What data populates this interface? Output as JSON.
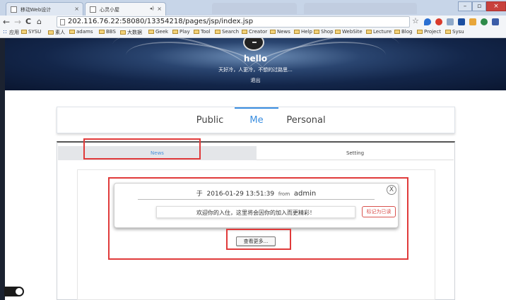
{
  "browser": {
    "tabs": [
      {
        "title": "移动Web设计"
      },
      {
        "title": "心灵小屋"
      }
    ],
    "address": "202.116.76.22:58080/13354218/pages/jsp/index.jsp",
    "bookmarks": [
      "应用",
      "SYSU",
      "素人",
      "adams",
      "BBS",
      "大数据",
      "Geek",
      "Play",
      "Tool",
      "Search",
      "Creator",
      "News",
      "Help",
      "Shop",
      "WebSite",
      "Lecture",
      "Blog",
      "Project",
      "Sysu"
    ]
  },
  "banner": {
    "title": "hello",
    "motto": "天好冷，人更冷，不想的过路思...",
    "logout": "退出"
  },
  "main_tabs": [
    "Public",
    "Me",
    "Personal"
  ],
  "sub_tabs": {
    "news": "News",
    "setting": "Setting"
  },
  "message": {
    "prefix": "于",
    "datetime": "2016-01-29 13:51:39",
    "from_label": "from",
    "user": "admin",
    "close": "X",
    "body": "欢迎你的入住，这里将会因你的加入而更精彩！",
    "mark_read": "标记为已读"
  },
  "more_button": "查看更多..."
}
